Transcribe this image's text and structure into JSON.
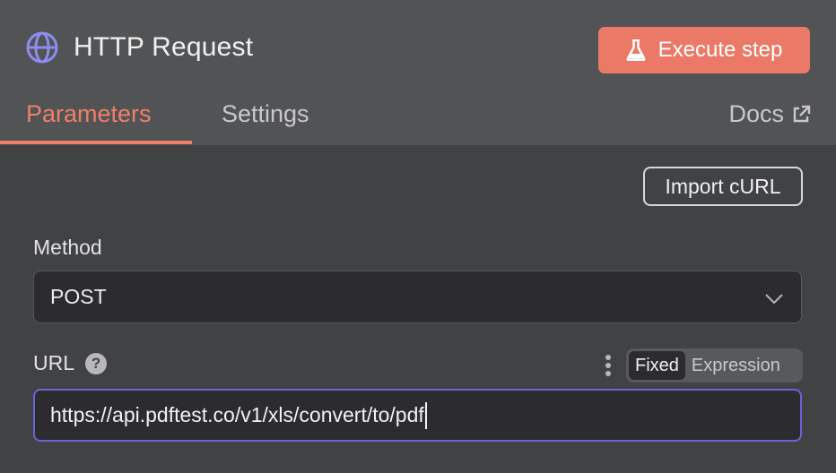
{
  "node": {
    "title": "HTTP Request",
    "execute_label": "Execute step",
    "accent": "#ea7a67"
  },
  "tabs": [
    {
      "label": "Parameters",
      "active": true
    },
    {
      "label": "Settings",
      "active": false
    }
  ],
  "docs": {
    "label": "Docs",
    "icon": "external-link-icon"
  },
  "import_curl_label": "Import cURL",
  "method": {
    "label": "Method",
    "value": "POST"
  },
  "url": {
    "label": "URL",
    "help_icon": "question-icon",
    "value": "https://api.pdftest.co/v1/xls/convert/to/pdf",
    "mode_options": [
      "Fixed",
      "Expression"
    ],
    "mode_selected": "Fixed",
    "focus_color": "#6c63d6"
  },
  "icons": {
    "title_icon": "globe-icon",
    "execute_icon": "flask-icon",
    "method_dropdown_icon": "chevron-down-icon",
    "url_options_icon": "kebab-icon"
  }
}
